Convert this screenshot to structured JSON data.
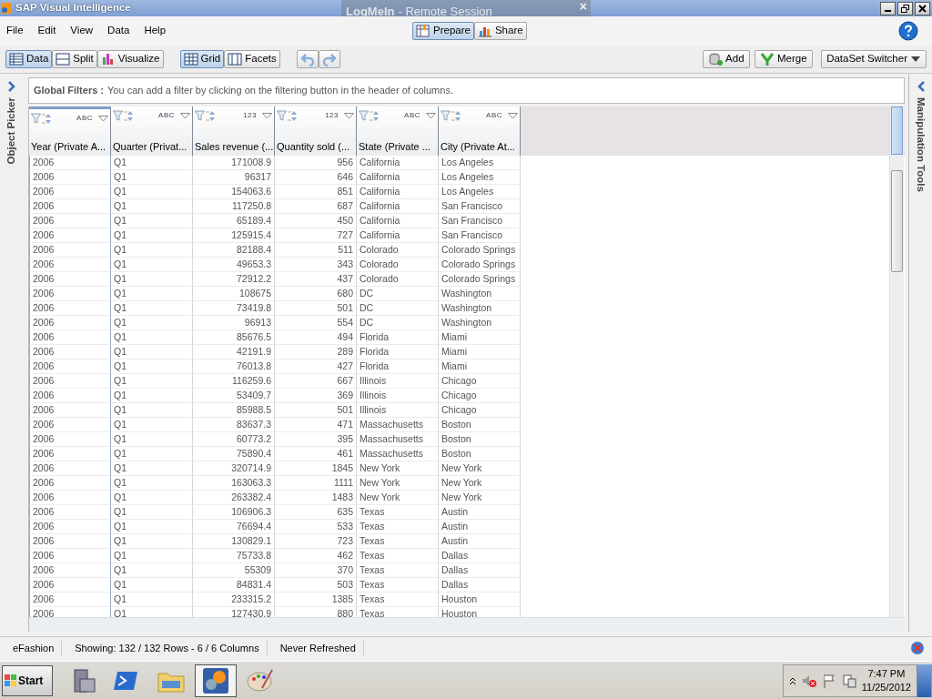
{
  "window": {
    "title": "SAP Visual Intelligence"
  },
  "remote_session": {
    "brand": "LogMeIn",
    "title": "- Remote Session",
    "close": "×"
  },
  "menu": [
    "File",
    "Edit",
    "View",
    "Data",
    "Help"
  ],
  "modes": [
    {
      "label": "Prepare",
      "selected": true,
      "kind": "prepare"
    },
    {
      "label": "Share",
      "selected": false,
      "kind": "share"
    }
  ],
  "views": [
    {
      "label": "Data",
      "selected": true,
      "kind": "data"
    },
    {
      "label": "Split",
      "selected": false,
      "kind": "split"
    },
    {
      "label": "Visualize",
      "selected": false,
      "kind": "chart"
    }
  ],
  "layouts": [
    {
      "label": "Grid",
      "selected": true,
      "kind": "grid"
    },
    {
      "label": "Facets",
      "selected": false,
      "kind": "facets"
    }
  ],
  "actions": [
    {
      "label": "Add",
      "kind": "add"
    },
    {
      "label": "Merge",
      "kind": "merge"
    }
  ],
  "dataset_switcher": "DataSet Switcher",
  "left_panel": "Object Picker",
  "right_panel": "Manipulation Tools",
  "global_filters": {
    "label": "Global Filters :",
    "hint": "You can add a filter by clicking on the filtering button in the header of columns."
  },
  "table": {
    "columns": [
      {
        "name": "Year (Private A...",
        "type_label": "ABC",
        "kind": "text",
        "selected": true
      },
      {
        "name": "Quarter (Privat...",
        "type_label": "ABC",
        "kind": "text",
        "selected": false
      },
      {
        "name": "Sales revenue (...",
        "type_label": "123",
        "kind": "number",
        "selected": false
      },
      {
        "name": "Quantity sold (...",
        "type_label": "123",
        "kind": "number",
        "selected": false
      },
      {
        "name": "State (Private ...",
        "type_label": "ABC",
        "kind": "text",
        "selected": false
      },
      {
        "name": "City (Private At...",
        "type_label": "ABC",
        "kind": "text",
        "selected": false
      }
    ],
    "rows": [
      [
        "2006",
        "Q1",
        "171008.9",
        "956",
        "California",
        "Los Angeles"
      ],
      [
        "2006",
        "Q1",
        "96317",
        "646",
        "California",
        "Los Angeles"
      ],
      [
        "2006",
        "Q1",
        "154063.6",
        "851",
        "California",
        "Los Angeles"
      ],
      [
        "2006",
        "Q1",
        "117250.8",
        "687",
        "California",
        "San Francisco"
      ],
      [
        "2006",
        "Q1",
        "65189.4",
        "450",
        "California",
        "San Francisco"
      ],
      [
        "2006",
        "Q1",
        "125915.4",
        "727",
        "California",
        "San Francisco"
      ],
      [
        "2006",
        "Q1",
        "82188.4",
        "511",
        "Colorado",
        "Colorado Springs"
      ],
      [
        "2006",
        "Q1",
        "49653.3",
        "343",
        "Colorado",
        "Colorado Springs"
      ],
      [
        "2006",
        "Q1",
        "72912.2",
        "437",
        "Colorado",
        "Colorado Springs"
      ],
      [
        "2006",
        "Q1",
        "108675",
        "680",
        "DC",
        "Washington"
      ],
      [
        "2006",
        "Q1",
        "73419.8",
        "501",
        "DC",
        "Washington"
      ],
      [
        "2006",
        "Q1",
        "96913",
        "554",
        "DC",
        "Washington"
      ],
      [
        "2006",
        "Q1",
        "85676.5",
        "494",
        "Florida",
        "Miami"
      ],
      [
        "2006",
        "Q1",
        "42191.9",
        "289",
        "Florida",
        "Miami"
      ],
      [
        "2006",
        "Q1",
        "76013.8",
        "427",
        "Florida",
        "Miami"
      ],
      [
        "2006",
        "Q1",
        "116259.6",
        "667",
        "Illinois",
        "Chicago"
      ],
      [
        "2006",
        "Q1",
        "53409.7",
        "369",
        "Illinois",
        "Chicago"
      ],
      [
        "2006",
        "Q1",
        "85988.5",
        "501",
        "Illinois",
        "Chicago"
      ],
      [
        "2006",
        "Q1",
        "83637.3",
        "471",
        "Massachusetts",
        "Boston"
      ],
      [
        "2006",
        "Q1",
        "60773.2",
        "395",
        "Massachusetts",
        "Boston"
      ],
      [
        "2006",
        "Q1",
        "75890.4",
        "461",
        "Massachusetts",
        "Boston"
      ],
      [
        "2006",
        "Q1",
        "320714.9",
        "1845",
        "New York",
        "New York"
      ],
      [
        "2006",
        "Q1",
        "163063.3",
        "1111",
        "New York",
        "New York"
      ],
      [
        "2006",
        "Q1",
        "263382.4",
        "1483",
        "New York",
        "New York"
      ],
      [
        "2006",
        "Q1",
        "106906.3",
        "635",
        "Texas",
        "Austin"
      ],
      [
        "2006",
        "Q1",
        "76694.4",
        "533",
        "Texas",
        "Austin"
      ],
      [
        "2006",
        "Q1",
        "130829.1",
        "723",
        "Texas",
        "Austin"
      ],
      [
        "2006",
        "Q1",
        "75733.8",
        "462",
        "Texas",
        "Dallas"
      ],
      [
        "2006",
        "Q1",
        "55309",
        "370",
        "Texas",
        "Dallas"
      ],
      [
        "2006",
        "Q1",
        "84831.4",
        "503",
        "Texas",
        "Dallas"
      ],
      [
        "2006",
        "Q1",
        "233315.2",
        "1385",
        "Texas",
        "Houston"
      ],
      [
        "2006",
        "Q1",
        "127430.9",
        "880",
        "Texas",
        "Houston"
      ]
    ]
  },
  "status_bar": [
    "eFashion",
    "Showing: 132 / 132 Rows - 6 / 6 Columns",
    "Never Refreshed"
  ],
  "taskbar": {
    "start": "Start",
    "apps": [
      {
        "kind": "server",
        "selected": false
      },
      {
        "kind": "powershell",
        "selected": false
      },
      {
        "kind": "folder",
        "selected": false
      },
      {
        "kind": "visual",
        "selected": true
      },
      {
        "kind": "paint",
        "selected": false
      }
    ],
    "time": "7:47 PM",
    "date": "11/25/2012"
  }
}
